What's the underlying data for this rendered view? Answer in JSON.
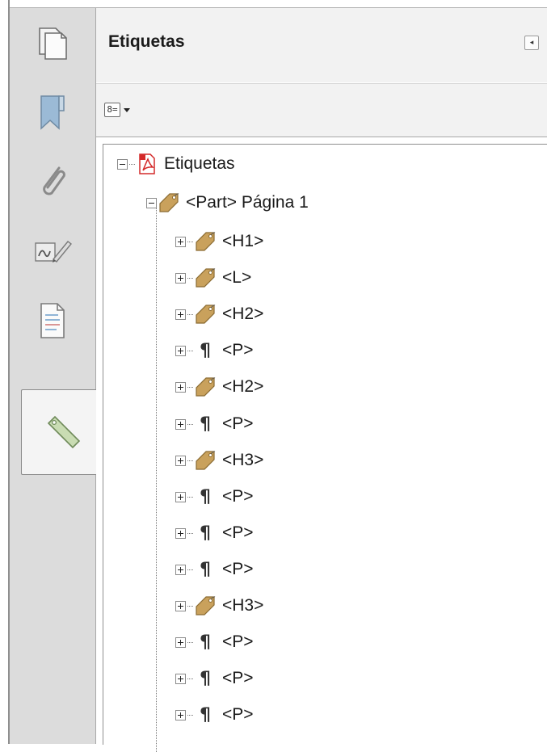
{
  "panel": {
    "title": "Etiquetas",
    "collapse_icon": "chevron-left-icon",
    "options_icon": "options-menu-icon"
  },
  "nav_rail": [
    {
      "name": "page-thumbnails",
      "icon": "pages-icon"
    },
    {
      "name": "bookmarks",
      "icon": "bookmark-icon"
    },
    {
      "name": "attachments",
      "icon": "paperclip-icon"
    },
    {
      "name": "signatures",
      "icon": "signature-icon"
    },
    {
      "name": "content",
      "icon": "document-icon"
    },
    {
      "name": "tags",
      "icon": "tag-icon",
      "active": true
    }
  ],
  "tree": {
    "root": {
      "label": "Etiquetas",
      "icon": "pdf-icon",
      "expanded": true
    },
    "part": {
      "label": "<Part> Página 1",
      "icon": "tag-icon",
      "expanded": true
    },
    "children": [
      {
        "label": "<H1>",
        "icon": "tag-icon"
      },
      {
        "label": "<L>",
        "icon": "tag-icon"
      },
      {
        "label": "<H2>",
        "icon": "tag-icon"
      },
      {
        "label": "<P>",
        "icon": "paragraph-icon"
      },
      {
        "label": "<H2>",
        "icon": "tag-icon"
      },
      {
        "label": "<P>",
        "icon": "paragraph-icon"
      },
      {
        "label": "<H3>",
        "icon": "tag-icon"
      },
      {
        "label": "<P>",
        "icon": "paragraph-icon"
      },
      {
        "label": "<P>",
        "icon": "paragraph-icon"
      },
      {
        "label": "<P>",
        "icon": "paragraph-icon"
      },
      {
        "label": "<H3>",
        "icon": "tag-icon"
      },
      {
        "label": "<P>",
        "icon": "paragraph-icon"
      },
      {
        "label": "<P>",
        "icon": "paragraph-icon"
      },
      {
        "label": "<P>",
        "icon": "paragraph-icon"
      }
    ]
  },
  "colors": {
    "tag_gold": "#c9a15c",
    "pdf_red": "#d42a2a",
    "rail_bg": "#dcdcdc",
    "panel_header_bg": "#f2f2f2"
  }
}
